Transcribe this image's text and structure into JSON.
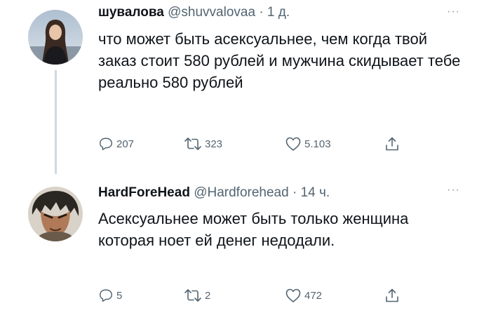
{
  "tweets": [
    {
      "name": "шувалова",
      "handle": "@shuvvalovaa",
      "separator": "·",
      "time": "1 д.",
      "text": "что может быть асексуальнее, чем когда твой заказ стоит 580 рублей и мужчина скидывает тебе реально 580 рублей",
      "replies": "207",
      "retweets": "323",
      "likes": "5.103",
      "more": "···"
    },
    {
      "name": "HardForeHead",
      "handle": "@Hardforehead",
      "separator": "·",
      "time": "14 ч.",
      "text": "Асексуальнее может быть только женщина которая ноет ей денег недодали.",
      "replies": "5",
      "retweets": "2",
      "likes": "472",
      "more": "···"
    }
  ],
  "icons": {
    "reply": "reply-icon",
    "retweet": "retweet-icon",
    "like": "like-icon",
    "share": "share-icon",
    "more": "more-icon"
  },
  "colors": {
    "text": "#0f1419",
    "secondary": "#536471",
    "thread_line": "#cfd9de"
  }
}
